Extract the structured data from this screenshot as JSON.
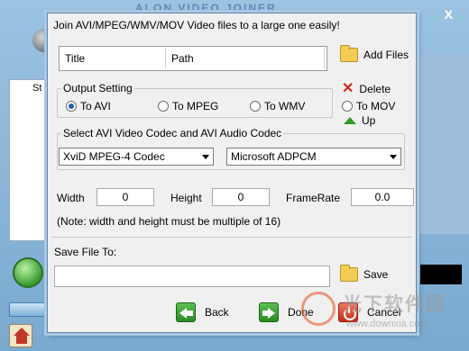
{
  "background": {
    "title": "ALON   VIDEO   JOINER",
    "close_label": "X",
    "partial_label": "St"
  },
  "dialog": {
    "title": "Join AVI/MPEG/WMV/MOV  Video files to a large one easily!",
    "list_headers": [
      "Title",
      "Path"
    ],
    "buttons": {
      "add_files": "Add Files",
      "delete": "Delete",
      "up": "Up",
      "save": "Save",
      "back": "Back",
      "done": "Done",
      "cancel": "Cancel"
    },
    "output_setting": {
      "legend": "Output Setting",
      "options": [
        "To AVI",
        "To MPEG",
        "To WMV",
        "To MOV"
      ],
      "selected": "To AVI"
    },
    "codec": {
      "legend": "Select AVI Video Codec and AVI Audio Codec",
      "video_codec": "XviD MPEG-4 Codec",
      "audio_codec": "Microsoft ADPCM"
    },
    "params": {
      "width_label": "Width",
      "width_value": "0",
      "height_label": "Height",
      "height_value": "0",
      "framerate_label": "FrameRate",
      "framerate_value": "0.0",
      "note": "(Note: width and height must be multiple of 16)"
    },
    "save_file": {
      "label": "Save File To:",
      "value": ""
    }
  },
  "watermark": {
    "text": "光下软件园",
    "url": "www.downxia.com"
  },
  "colors": {
    "dialog_bg": "#f0f0f0",
    "accent_green": "#2e9b2a",
    "accent_red": "#d42a1e",
    "radio_dot": "#1e5bb8"
  }
}
